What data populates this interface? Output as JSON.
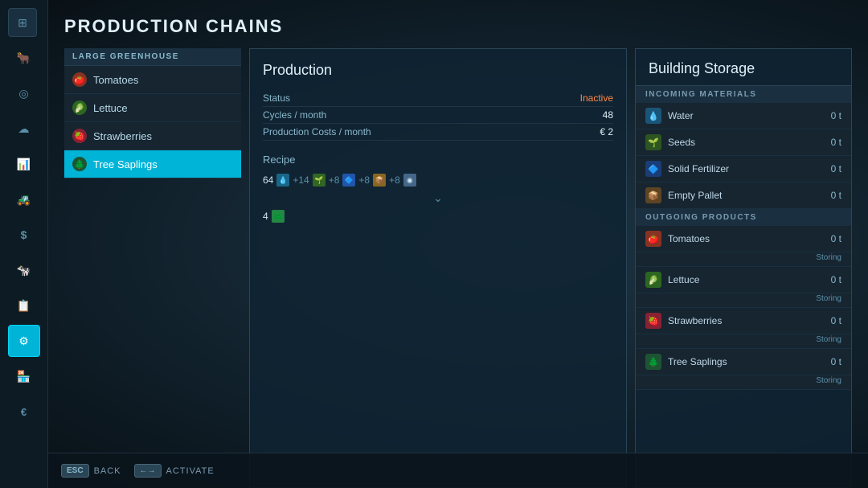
{
  "app": {
    "corner_icon": "⊞"
  },
  "sidebar": {
    "icons": [
      {
        "id": "map-icon",
        "symbol": "◻",
        "active": false
      },
      {
        "id": "animals-icon",
        "symbol": "🐂",
        "active": false
      },
      {
        "id": "steering-icon",
        "symbol": "◎",
        "active": false
      },
      {
        "id": "weather-icon",
        "symbol": "☁",
        "active": false
      },
      {
        "id": "chart-icon",
        "symbol": "📊",
        "active": false
      },
      {
        "id": "tractor-icon",
        "symbol": "🚜",
        "active": false
      },
      {
        "id": "money-icon",
        "symbol": "$",
        "active": false
      },
      {
        "id": "cattle-icon",
        "symbol": "🐄",
        "active": false
      },
      {
        "id": "contracts-icon",
        "symbol": "📋",
        "active": false
      },
      {
        "id": "factory-icon",
        "symbol": "⚙",
        "active": true
      },
      {
        "id": "market-icon",
        "symbol": "🏪",
        "active": false
      },
      {
        "id": "currency-icon",
        "symbol": "€",
        "active": false
      }
    ]
  },
  "page": {
    "title": "PRODUCTION CHAINS"
  },
  "chains": {
    "section_header": "LARGE GREENHOUSE",
    "items": [
      {
        "id": "tomatoes",
        "label": "Tomatoes",
        "icon": "🍅",
        "icon_color": "#cc3322",
        "active": false
      },
      {
        "id": "lettuce",
        "label": "Lettuce",
        "icon": "🥬",
        "icon_color": "#44aa33",
        "active": false
      },
      {
        "id": "strawberries",
        "label": "Strawberries",
        "icon": "🍓",
        "icon_color": "#dd2244",
        "active": false
      },
      {
        "id": "tree-saplings",
        "label": "Tree Saplings",
        "icon": "🌲",
        "icon_color": "#228844",
        "active": true
      }
    ]
  },
  "production": {
    "title": "Production",
    "rows": [
      {
        "label": "Status",
        "value": "Inactive",
        "value_class": "inactive"
      },
      {
        "label": "Cycles / month",
        "value": "48"
      },
      {
        "label": "Production Costs / month",
        "value": "€ 2"
      }
    ],
    "recipe": {
      "label": "Recipe",
      "ingredients": [
        {
          "amount": "64",
          "icon": "💧",
          "icon_bg": "#1a6688"
        },
        {
          "plus": "+14",
          "icon": "🌱",
          "icon_bg": "#336622"
        },
        {
          "plus": "+8",
          "icon": "🔷",
          "icon_bg": "#2255aa"
        },
        {
          "plus": "+8",
          "icon": "📦",
          "icon_bg": "#886622"
        },
        {
          "plus": "+8",
          "icon": "🔘",
          "icon_bg": "#446688"
        }
      ],
      "output_amount": "4",
      "output_icon": "🌲",
      "output_icon_bg": "#228844"
    }
  },
  "storage": {
    "title": "Building Storage",
    "incoming": {
      "header": "INCOMING MATERIALS",
      "items": [
        {
          "label": "Water",
          "value": "0 t",
          "icon": "💧",
          "icon_bg": "#1a5577"
        },
        {
          "label": "Seeds",
          "value": "0 t",
          "icon": "🌱",
          "icon_bg": "#2d5522"
        },
        {
          "label": "Solid Fertilizer",
          "value": "0 t",
          "icon": "🔷",
          "icon_bg": "#1a3d77"
        },
        {
          "label": "Empty Pallet",
          "value": "0 t",
          "icon": "📦",
          "icon_bg": "#5d4422"
        }
      ]
    },
    "outgoing": {
      "header": "OUTGOING PRODUCTS",
      "items": [
        {
          "label": "Tomatoes",
          "value": "0 t",
          "sub": "Storing",
          "icon": "🍅",
          "icon_bg": "#883322"
        },
        {
          "label": "Lettuce",
          "value": "0 t",
          "sub": "Storing",
          "icon": "🥬",
          "icon_bg": "#2d6622"
        },
        {
          "label": "Strawberries",
          "value": "0 t",
          "sub": "Storing",
          "icon": "🍓",
          "icon_bg": "#882233"
        },
        {
          "label": "Tree Saplings",
          "value": "0 t",
          "sub": "Storing",
          "icon": "🌲",
          "icon_bg": "#1d5533"
        }
      ]
    }
  },
  "bottom_bar": {
    "back_key": "ESC",
    "back_label": "BACK",
    "activate_key": "←→",
    "activate_label": "ACTIVATE"
  }
}
